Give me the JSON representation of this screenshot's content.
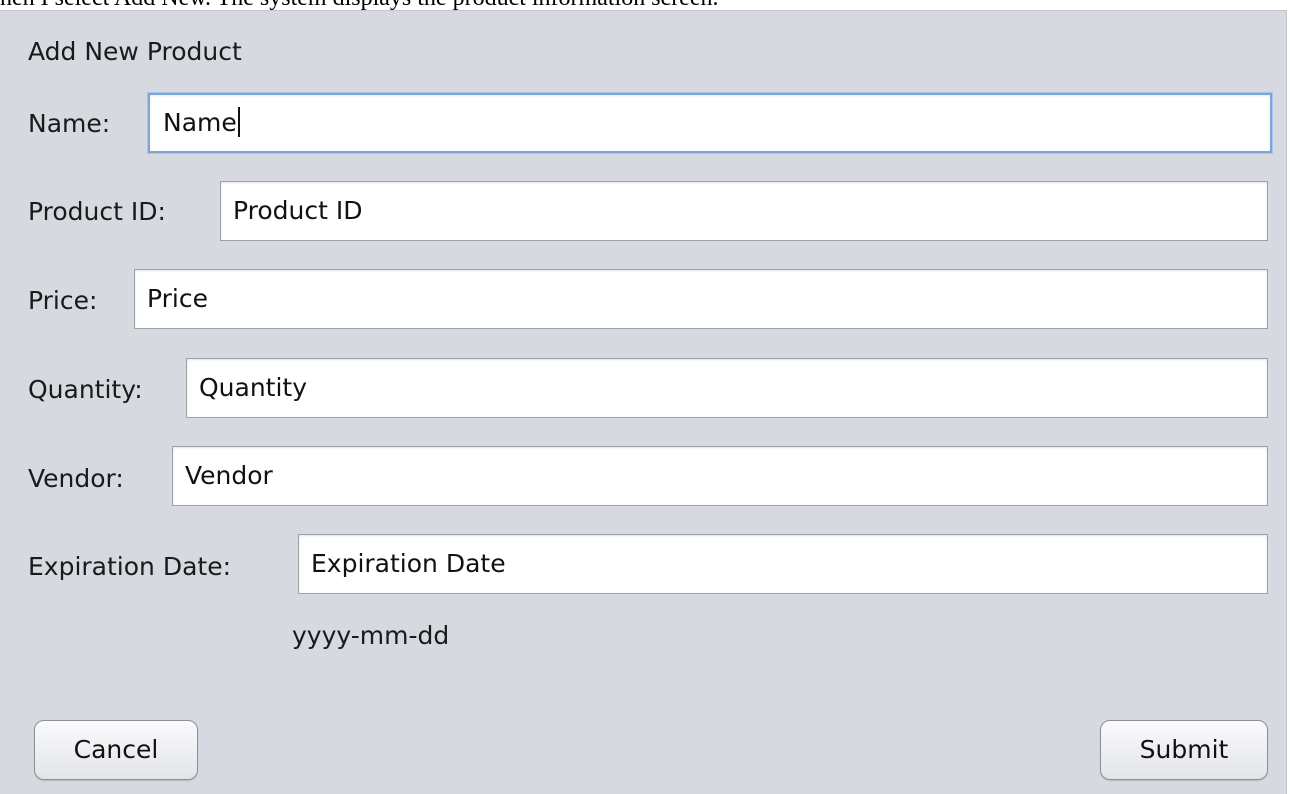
{
  "caption": "hen I select Add New. The system displays the product information screen.",
  "dialog": {
    "title": "Add New Product",
    "fields": {
      "name": {
        "label": "Name:",
        "value": "Name"
      },
      "product_id": {
        "label": "Product ID:",
        "value": "Product ID"
      },
      "price": {
        "label": "Price:",
        "value": "Price"
      },
      "quantity": {
        "label": "Quantity:",
        "value": "Quantity"
      },
      "vendor": {
        "label": "Vendor:",
        "value": "Vendor"
      },
      "expiration_date": {
        "label": "Expiration Date:",
        "value": "Expiration Date",
        "format_hint": "yyyy-mm-dd"
      }
    },
    "buttons": {
      "cancel": "Cancel",
      "submit": "Submit"
    }
  },
  "colors": {
    "panel_bg": "#d6d9df",
    "focus_ring": "#7ea6d4"
  }
}
